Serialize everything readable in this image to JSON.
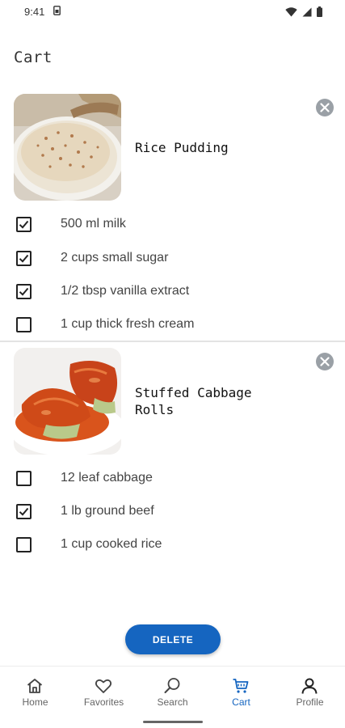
{
  "status_bar": {
    "time": "9:41",
    "sim_icon": "sim-icon",
    "icons": [
      "wifi-icon",
      "signal-icon",
      "battery-icon"
    ]
  },
  "page": {
    "title": "Cart"
  },
  "cart_items": [
    {
      "title": "Rice Pudding",
      "image": "rice-pudding-photo",
      "remove_icon": "close-circle-icon",
      "ingredients": [
        {
          "label": "500 ml milk",
          "checked": true
        },
        {
          "label": "2 cups small sugar",
          "checked": true
        },
        {
          "label": "1/2 tbsp vanilla extract",
          "checked": true
        },
        {
          "label": "1 cup thick fresh cream",
          "checked": false
        }
      ]
    },
    {
      "title": "Stuffed Cabbage\nRolls",
      "image": "stuffed-cabbage-rolls-photo",
      "remove_icon": "close-circle-icon",
      "ingredients": [
        {
          "label": "12 leaf cabbage",
          "checked": false
        },
        {
          "label": "1 lb ground beef",
          "checked": true
        },
        {
          "label": "1 cup cooked rice",
          "checked": false
        }
      ]
    }
  ],
  "actions": {
    "delete_label": "DELETE"
  },
  "bottom_nav": {
    "items": [
      {
        "label": "Home",
        "icon": "home-icon",
        "active": false
      },
      {
        "label": "Favorites",
        "icon": "heart-icon",
        "active": false
      },
      {
        "label": "Search",
        "icon": "search-icon",
        "active": false
      },
      {
        "label": "Cart",
        "icon": "cart-icon",
        "active": true
      },
      {
        "label": "Profile",
        "icon": "person-icon",
        "active": false
      }
    ]
  },
  "colors": {
    "accent": "#1565c0",
    "remove_button": "#9aa0a6",
    "divider": "#e3e3e3"
  }
}
